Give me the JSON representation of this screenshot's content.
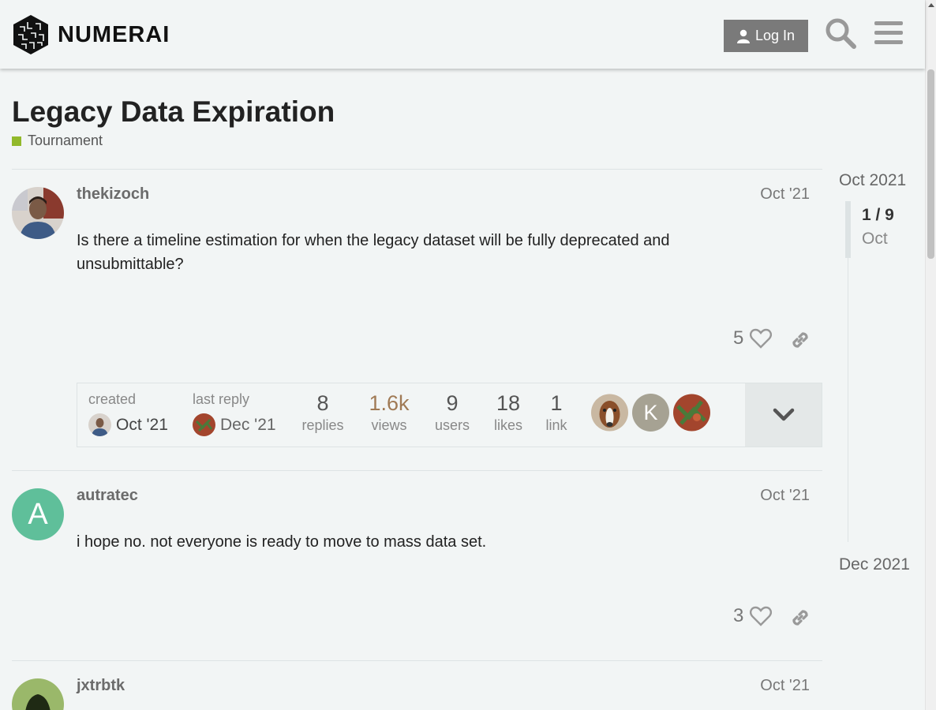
{
  "header": {
    "brand": "NUMERAI",
    "login_label": "Log In"
  },
  "topic": {
    "title": "Legacy Data Expiration",
    "category": "Tournament",
    "category_color": "#92b92b"
  },
  "posts": [
    {
      "username": "thekizoch",
      "date": "Oct '21",
      "body": "Is there a timeline estimation for when the legacy dataset will be fully deprecated and unsubmittable?",
      "likes": "5"
    },
    {
      "username": "autratec",
      "avatar_letter": "A",
      "date": "Oct '21",
      "body": "i hope no. not everyone is ready to move to mass data set.",
      "likes": "3"
    },
    {
      "username": "jxtrbtk",
      "date": "Oct '21"
    }
  ],
  "topic_map": {
    "created_label": "created",
    "created_date": "Oct '21",
    "last_reply_label": "last reply",
    "last_reply_date": "Dec '21",
    "stats": [
      {
        "num": "8",
        "label": "replies"
      },
      {
        "num": "1.6k",
        "label": "views"
      },
      {
        "num": "9",
        "label": "users"
      },
      {
        "num": "18",
        "label": "likes"
      },
      {
        "num": "1",
        "label": "link"
      }
    ],
    "participant_letter": "K"
  },
  "timeline": {
    "start": "Oct 2021",
    "position": "1 / 9",
    "position_date": "Oct",
    "end": "Dec 2021"
  },
  "icons": [
    "user-icon",
    "search-icon",
    "hamburger-icon",
    "heart-icon",
    "link-icon",
    "chevron-down-icon"
  ],
  "colors": {
    "accent_gray": "#7a7a7a",
    "avatar_teal": "#5fbf9a",
    "views_color": "#a07a55"
  }
}
